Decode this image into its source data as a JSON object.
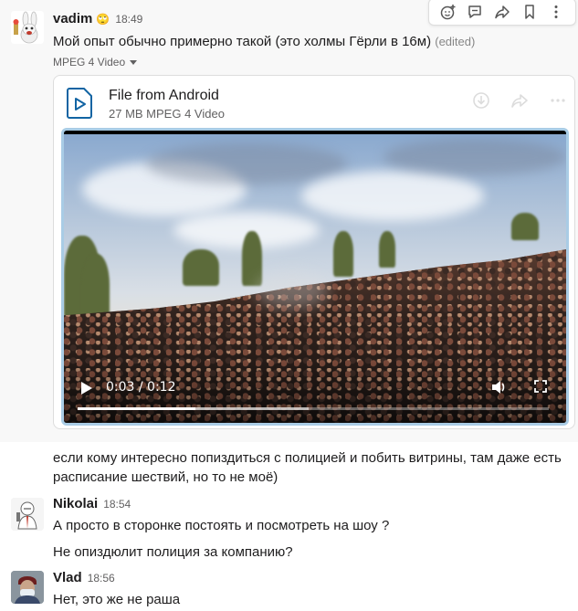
{
  "messages": [
    {
      "author": "vadim",
      "status_emoji": "🙄",
      "time": "18:49",
      "text": "Мой опыт обычно примерно такой (это холмы Гёрли в 16м)",
      "edited": "(edited)",
      "attachment": {
        "kind_label": "MPEG 4 Video",
        "title": "File from Android",
        "meta": "27 MB MPEG 4 Video",
        "video": {
          "current_time": "0:03 / 0:12",
          "progress": 0.25,
          "buffered": 0.49
        }
      },
      "followup": [
        "если кому интересно попиздиться с полицией и побить витрины, там даже есть",
        "расписание шествий, но то не моё)"
      ]
    },
    {
      "author": "Nikolai",
      "time": "18:54",
      "lines": [
        "А просто в сторонке постоять и посмотреть на шоу ?",
        "Не опиздюлит полиция за компанию?"
      ]
    },
    {
      "author": "Vlad",
      "time": "18:56",
      "lines": [
        "Нет, это же не раша"
      ]
    }
  ],
  "toolbar": {
    "icons": [
      "add-reaction-icon",
      "reply-thread-icon",
      "share-icon",
      "bookmark-icon",
      "more-icon"
    ]
  },
  "colors": {
    "link_blue": "#1264a3",
    "video_border": "#a9cce5"
  }
}
